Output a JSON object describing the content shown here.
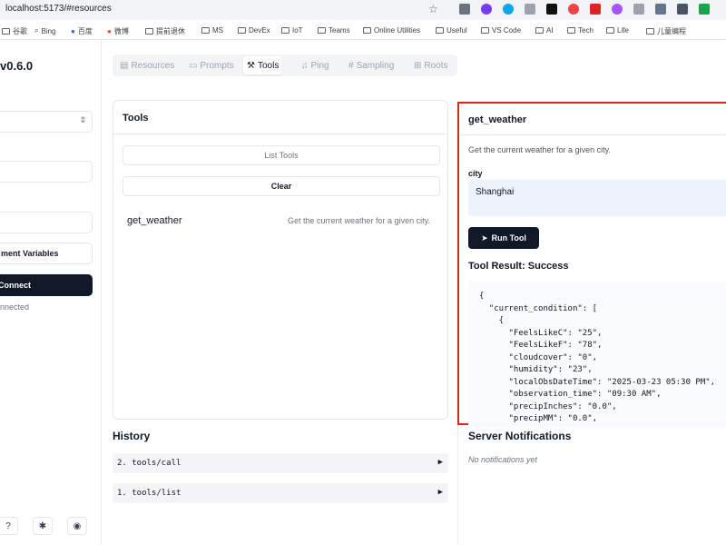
{
  "browser": {
    "url": "localhost:5173/#resources",
    "bookmarks": [
      "谷歌",
      "Bing",
      "百度",
      "微博",
      "提前退休",
      "MS",
      "DevEx",
      "IoT",
      "Teams",
      "Online Utilities",
      "Useful",
      "VS Code",
      "AI",
      "Tech",
      "Life",
      "儿童编程"
    ]
  },
  "sidebar": {
    "version": "v0.6.0",
    "env_button": "ment Variables",
    "connect_button": "Connect",
    "status": "nnected",
    "footer_icons": [
      "help-icon",
      "bug-icon",
      "github-icon"
    ]
  },
  "tabs": [
    "Resources",
    "Prompts",
    "Tools",
    "Ping",
    "Sampling",
    "Roots"
  ],
  "active_tab": "Tools",
  "tools_panel": {
    "title": "Tools",
    "list_button": "List Tools",
    "clear_button": "Clear",
    "tools": [
      {
        "name": "get_weather",
        "description": "Get the current weather for a given city."
      }
    ]
  },
  "tool_detail": {
    "title": "get_weather",
    "description": "Get the current weather for a given city.",
    "param_label": "city",
    "param_value": "Shanghai",
    "run_button": "Run Tool",
    "result_title": "Tool Result: Success",
    "result_lines": [
      "{",
      "  \"current_condition\": [",
      "    {",
      "      \"FeelsLikeC\": \"25\",",
      "      \"FeelsLikeF\": \"78\",",
      "      \"cloudcover\": \"0\",",
      "      \"humidity\": \"23\",",
      "      \"localObsDateTime\": \"2025-03-23 05:30 PM\",",
      "      \"observation_time\": \"09:30 AM\",",
      "      \"precipInches\": \"0.0\",",
      "      \"precipMM\": \"0.0\","
    ]
  },
  "history": {
    "title": "History",
    "items": [
      {
        "label": "2. tools/call"
      },
      {
        "label": "1. tools/list"
      }
    ]
  },
  "notifications": {
    "title": "Server Notifications",
    "empty": "No notifications yet"
  },
  "colors": {
    "highlight_border": "#dc2626",
    "dark_button": "#111827",
    "input_bg": "#eef2fb"
  }
}
